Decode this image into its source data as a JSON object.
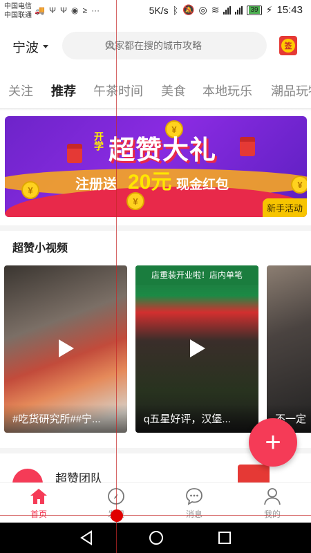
{
  "status_bar": {
    "carrier_1": "中国电信",
    "carrier_2": "中国联通",
    "speed": "5K/s",
    "battery": "39",
    "time": "15:43"
  },
  "header": {
    "city": "宁波",
    "search_placeholder": "大家都在搜的城市攻略",
    "checkin_label": "签"
  },
  "tabs": [
    "关注",
    "推荐",
    "午茶时间",
    "美食",
    "本地玩乐",
    "潮品玩物"
  ],
  "active_tab": "推荐",
  "banner": {
    "tag": "开学",
    "title": "超赞大礼",
    "subtitle_prefix": "注册送",
    "amount": "20元",
    "subtitle_suffix": "现金红包",
    "corner_label": "新手活动"
  },
  "videos_section": {
    "title": "超赞小视频",
    "items": [
      {
        "caption": "#吃货研究所##宁..."
      },
      {
        "caption": "q五星好评，汉堡...",
        "sign": "店重装开业啦！店内单笔"
      },
      {
        "caption": "不一定"
      }
    ]
  },
  "fab_label": "+",
  "team": {
    "name": "超赞团队"
  },
  "bottom_nav": [
    {
      "label": "首页",
      "icon": "home-icon",
      "active": true
    },
    {
      "label": "发现",
      "icon": "compass-icon",
      "active": false
    },
    {
      "label": "消息",
      "icon": "message-icon",
      "active": false
    },
    {
      "label": "我的",
      "icon": "profile-icon",
      "active": false
    }
  ],
  "colors": {
    "accent": "#f53b57",
    "banner_purple": "#6d24c9",
    "banner_yellow": "#f7c400"
  }
}
